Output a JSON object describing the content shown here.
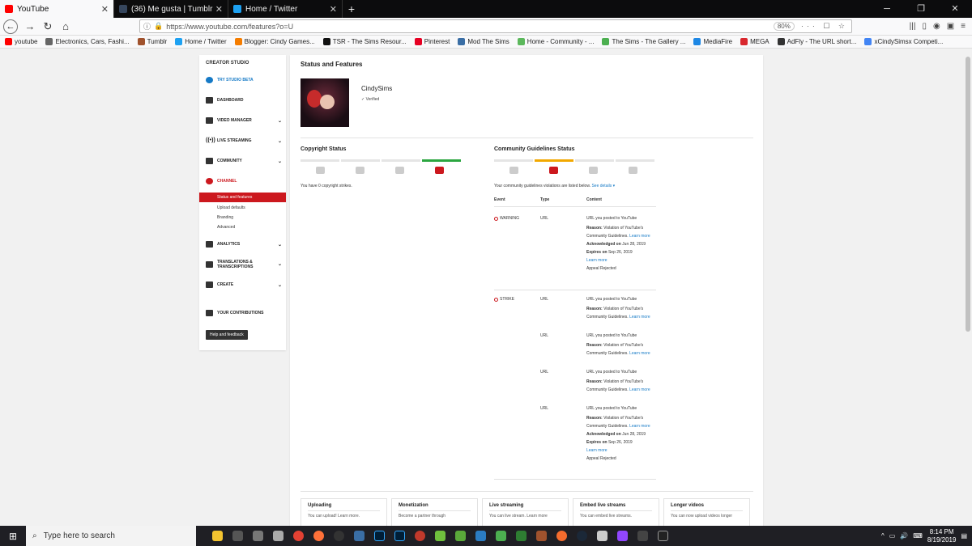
{
  "browser": {
    "tabs": [
      {
        "label": "YouTube",
        "active": true,
        "color": "#ff0000"
      },
      {
        "label": "(36) Me gusta | Tumblr",
        "active": false,
        "color": "#36465d"
      },
      {
        "label": "Home / Twitter",
        "active": false,
        "color": "#1da1f2"
      }
    ],
    "url": "https://www.youtube.com/features?o=U",
    "zoom": "80%",
    "bookmarks": [
      {
        "label": "youtube",
        "color": "#ff0000"
      },
      {
        "label": "Electronics, Cars, Fashi...",
        "color": "#666"
      },
      {
        "label": "Tumblr",
        "color": "#a0522d"
      },
      {
        "label": "Home / Twitter",
        "color": "#1da1f2"
      },
      {
        "label": "Blogger: Cindy Games...",
        "color": "#f57d00"
      },
      {
        "label": "TSR - The Sims Resour...",
        "color": "#111"
      },
      {
        "label": "Pinterest",
        "color": "#e60023"
      },
      {
        "label": "Mod The Sims",
        "color": "#3a6ea5"
      },
      {
        "label": "Home - Community - ...",
        "color": "#5cb85c"
      },
      {
        "label": "The Sims - The Gallery ...",
        "color": "#4caf50"
      },
      {
        "label": "MediaFire",
        "color": "#1e88e5"
      },
      {
        "label": "MEGA",
        "color": "#d9272e"
      },
      {
        "label": "AdFly - The URL short...",
        "color": "#333"
      },
      {
        "label": "xCindySimsx Competi...",
        "color": "#4285f4"
      }
    ]
  },
  "sidebar": {
    "heading": "CREATOR STUDIO",
    "items": [
      {
        "label": "TRY STUDIO BETA",
        "blue": true
      },
      {
        "label": "DASHBOARD"
      },
      {
        "label": "VIDEO MANAGER"
      },
      {
        "label": "LIVE STREAMING"
      },
      {
        "label": "COMMUNITY"
      },
      {
        "label": "CHANNEL",
        "red": true
      },
      {
        "label": "ANALYTICS"
      },
      {
        "label": "TRANSLATIONS & TRANSCRIPTIONS"
      },
      {
        "label": "CREATE"
      },
      {
        "label": "YOUR CONTRIBUTIONS"
      }
    ],
    "channel_subitems": [
      "Status and features",
      "Upload defaults",
      "Branding",
      "Advanced"
    ],
    "help_button": "Help and feedback"
  },
  "main": {
    "title": "Status and Features",
    "channel_name": "CindySims",
    "verified": "✓ Verified",
    "copyright": {
      "title": "Copyright Status",
      "note": "You have 0 copyright strikes."
    },
    "community": {
      "title": "Community Guidelines Status",
      "note": "Your community guidelines violations are listed below.",
      "see_details": "See details ▾",
      "headers": [
        "Event",
        "Type",
        "Content"
      ],
      "rows": [
        {
          "event": "WARNING",
          "type": "URL",
          "content": "URL you posted to YouTube",
          "reason": "Violation of YouTube's Community Guidelines.",
          "learn": "Learn more",
          "ack": "Jun 28, 2019",
          "expires": "Sep 26, 2019",
          "appeal": "Appeal Rejected"
        },
        {
          "event": "STRIKE",
          "type": "URL",
          "content": "URL you posted to YouTube",
          "reason": "Violation of YouTube's Community Guidelines.",
          "learn": "Learn more"
        },
        {
          "event": "",
          "type": "URL",
          "content": "URL you posted to YouTube",
          "reason": "Violation of YouTube's Community Guidelines.",
          "learn": "Learn more"
        },
        {
          "event": "",
          "type": "URL",
          "content": "URL you posted to YouTube",
          "reason": "Violation of YouTube's Community Guidelines.",
          "learn": "Learn more"
        },
        {
          "event": "",
          "type": "URL",
          "content": "URL you posted to YouTube",
          "reason": "Violation of YouTube's Community Guidelines.",
          "learn": "Learn more",
          "ack": "Jun 28, 2019",
          "expires": "Sep 26, 2019",
          "appeal": "Appeal Rejected"
        }
      ],
      "labels": {
        "reason": "Reason:",
        "ack": "Acknowledged on",
        "expires": "Expires on"
      }
    },
    "cards": [
      {
        "title": "Uploading",
        "desc": "You can upload! Learn more."
      },
      {
        "title": "Monetization",
        "desc": "Become a partner through"
      },
      {
        "title": "Live streaming",
        "desc": "You can live stream. Learn more"
      },
      {
        "title": "Embed live streams",
        "desc": "You can embed live streams."
      },
      {
        "title": "Longer videos",
        "desc": "You can now upload videos longer"
      }
    ]
  },
  "taskbar": {
    "search_placeholder": "Type here to search",
    "time": "8:14 PM",
    "date": "8/19/2019"
  }
}
